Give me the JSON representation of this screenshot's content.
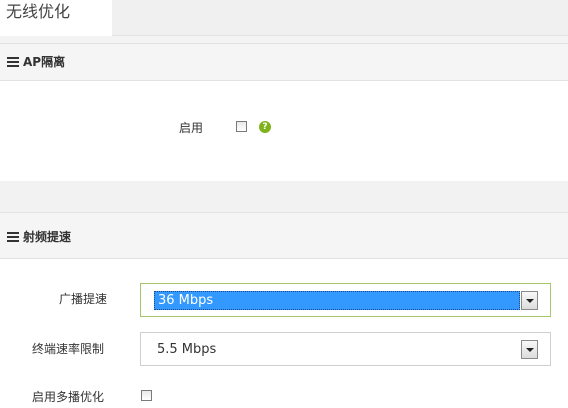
{
  "page": {
    "title": "无线优化"
  },
  "ap_isolation": {
    "section_title": "AP隔离",
    "enable_label": "启用",
    "enable_checked": false,
    "help_glyph": "?"
  },
  "rf_boost": {
    "section_title": "射频提速",
    "broadcast_rate_label": "广播提速",
    "broadcast_rate_value": "36 Mbps",
    "terminal_rate_limit_label": "终端速率限制",
    "terminal_rate_limit_value": "5.5 Mbps",
    "multicast_opt_label": "启用多播优化",
    "multicast_opt_checked": false
  },
  "icons": {
    "section": "menu-icon",
    "help": "help-icon",
    "dropdown": "chevron-down-icon"
  },
  "colors": {
    "help_icon": "#7fb21b",
    "selection_highlight": "#3399ff",
    "focused_border": "#a7c66b"
  }
}
